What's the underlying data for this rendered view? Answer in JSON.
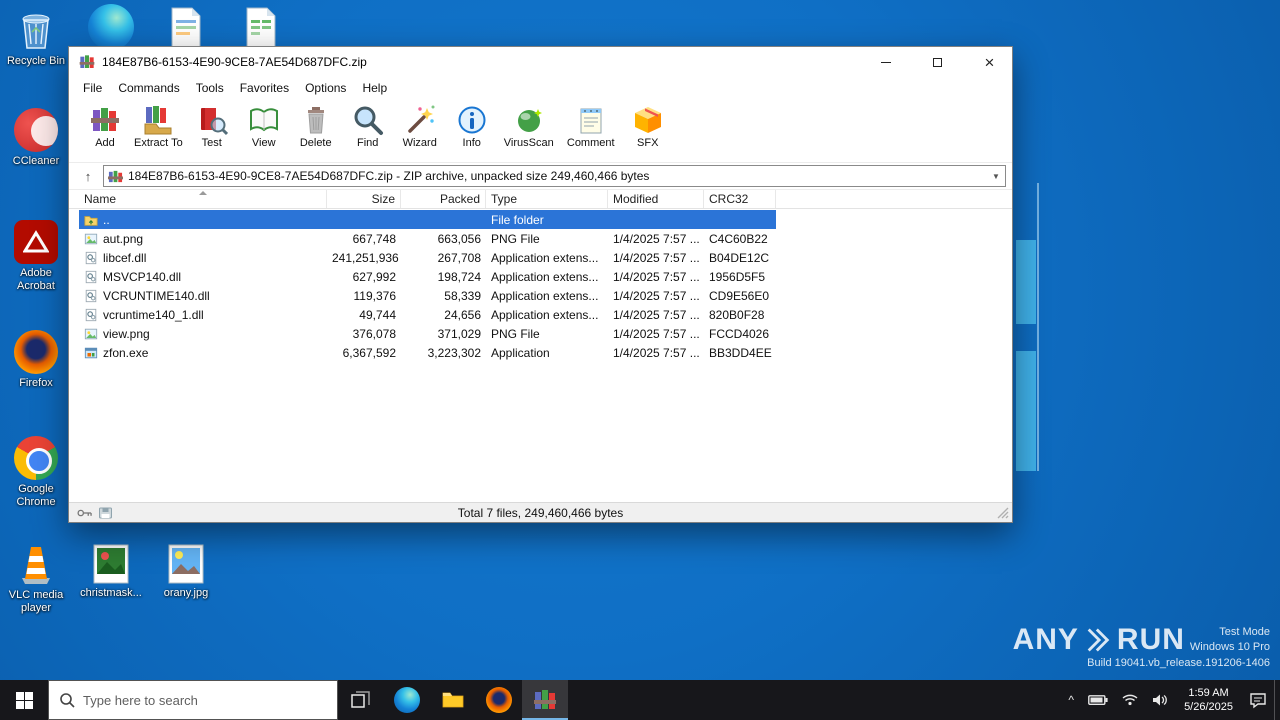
{
  "colors": {
    "desktop_blue": "#0f6fc5",
    "selection_blue": "#2b74d7",
    "taskbar_dark": "#17171b",
    "titlebar_white": "#ffffff"
  },
  "desktop": {
    "icons": [
      {
        "label": "Recycle Bin"
      },
      {
        "label": "CCleaner"
      },
      {
        "label": "Adobe Acrobat"
      },
      {
        "label": "Firefox"
      },
      {
        "label": "Google Chrome"
      },
      {
        "label": "VLC media player"
      },
      {
        "label": "christmask..."
      },
      {
        "label": "orany.jpg"
      }
    ]
  },
  "winrar": {
    "window_title": "184E87B6-6153-4E90-9CE8-7AE54D687DFC.zip",
    "menu": [
      "File",
      "Commands",
      "Tools",
      "Favorites",
      "Options",
      "Help"
    ],
    "toolbar": [
      "Add",
      "Extract To",
      "Test",
      "View",
      "Delete",
      "Find",
      "Wizard",
      "Info",
      "VirusScan",
      "Comment",
      "SFX"
    ],
    "address": "184E87B6-6153-4E90-9CE8-7AE54D687DFC.zip - ZIP archive, unpacked size 249,460,466 bytes",
    "columns": [
      "Name",
      "Size",
      "Packed",
      "Type",
      "Modified",
      "CRC32"
    ],
    "files": [
      {
        "name": "..",
        "size": "",
        "packed": "",
        "type": "File folder",
        "modified": "",
        "crc32": ""
      },
      {
        "name": "aut.png",
        "size": "667,748",
        "packed": "663,056",
        "type": "PNG File",
        "modified": "1/4/2025 7:57 ...",
        "crc32": "C4C60B22"
      },
      {
        "name": "libcef.dll",
        "size": "241,251,936",
        "packed": "267,708",
        "type": "Application extens...",
        "modified": "1/4/2025 7:57 ...",
        "crc32": "B04DE12C"
      },
      {
        "name": "MSVCP140.dll",
        "size": "627,992",
        "packed": "198,724",
        "type": "Application extens...",
        "modified": "1/4/2025 7:57 ...",
        "crc32": "1956D5F5"
      },
      {
        "name": "VCRUNTIME140.dll",
        "size": "119,376",
        "packed": "58,339",
        "type": "Application extens...",
        "modified": "1/4/2025 7:57 ...",
        "crc32": "CD9E56E0"
      },
      {
        "name": "vcruntime140_1.dll",
        "size": "49,744",
        "packed": "24,656",
        "type": "Application extens...",
        "modified": "1/4/2025 7:57 ...",
        "crc32": "820B0F28"
      },
      {
        "name": "view.png",
        "size": "376,078",
        "packed": "371,029",
        "type": "PNG File",
        "modified": "1/4/2025 7:57 ...",
        "crc32": "FCCD4026"
      },
      {
        "name": "zfon.exe",
        "size": "6,367,592",
        "packed": "3,223,302",
        "type": "Application",
        "modified": "1/4/2025 7:57 ...",
        "crc32": "BB3DD4EE"
      }
    ],
    "status": "Total 7 files, 249,460,466 bytes"
  },
  "taskbar": {
    "search_placeholder": "Type here to search",
    "clock_time": "1:59 AM",
    "clock_date": "5/26/2025"
  },
  "watermark": {
    "brand_left": "ANY",
    "brand_right": "RUN",
    "mode": "Test Mode",
    "os": "Windows 10 Pro",
    "build": "Build 19041.vb_release.191206-1406"
  },
  "icons": {
    "up_arrow": "↑",
    "dropdown_arrow": "▼",
    "close": "×",
    "tray_expand": "^"
  }
}
